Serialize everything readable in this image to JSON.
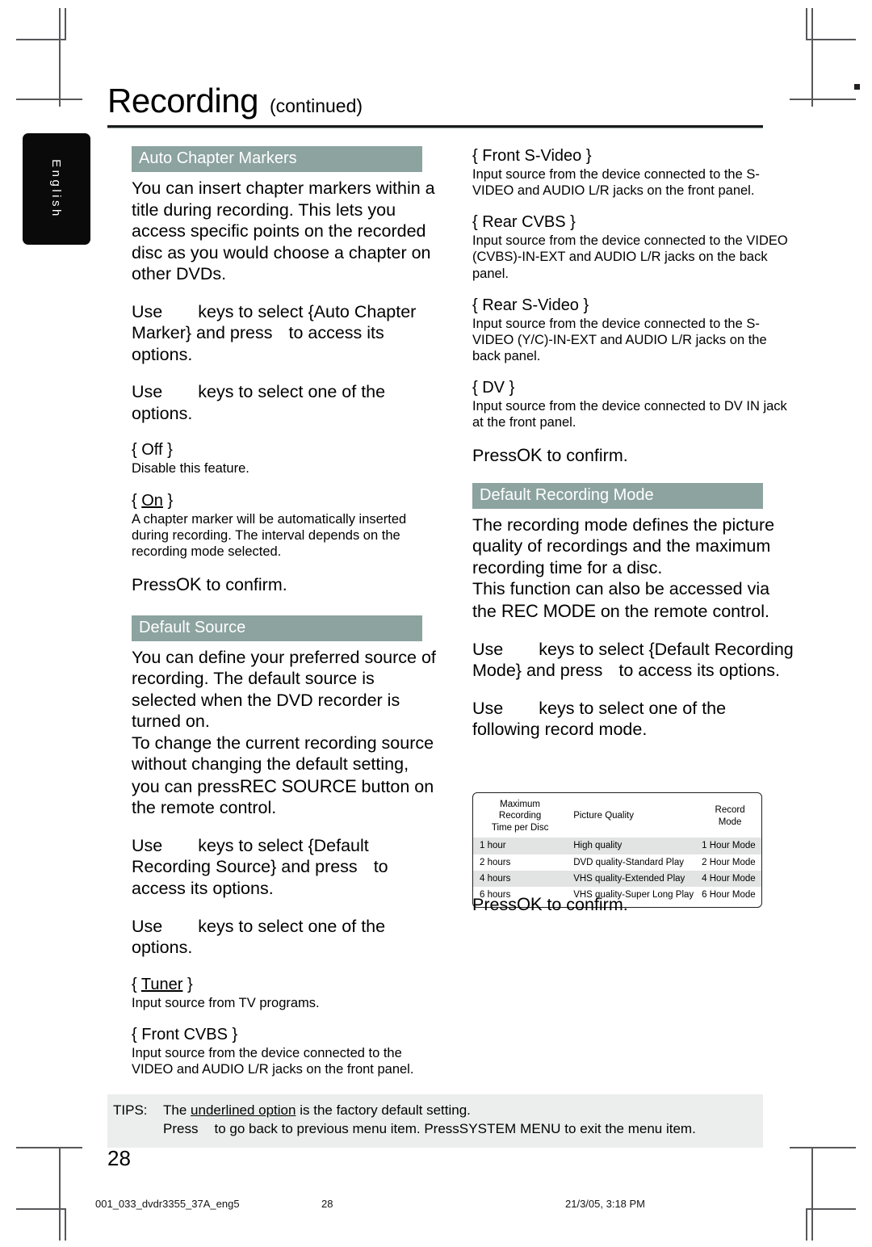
{
  "page": {
    "language_tab": "English",
    "folio": "28",
    "title": "Recording",
    "title_suffix": "(continued)"
  },
  "left_column": {
    "section1": {
      "heading": "Auto Chapter Markers",
      "intro": "You can insert chapter markers within a title during recording. This lets you access specific points on the recorded disc as you would choose a chapter on other DVDs.",
      "step1_a": "Use",
      "step1_b": "keys to select {",
      "step1_c": "Auto Chapter Marker",
      "step1_d": "} and press",
      "step1_e": "to access its options.",
      "step2_a": "Use",
      "step2_b": "keys to select one of the options.",
      "option_off": "{ Off }",
      "option_off_desc": "Disable this feature.",
      "option_on_open": "{",
      "option_on": "On",
      "option_on_close": "}",
      "option_on_desc": "A chapter marker will be automatically inserted during recording. The interval depends on the recording mode selected.",
      "confirm_a": "Press",
      "confirm_key": "OK",
      "confirm_b": "to confirm."
    },
    "section2": {
      "heading": "Default Source",
      "intro_1": "You can define your preferred source of recording. The default source is selected when the DVD recorder is turned on.",
      "intro_2_a": "To change the current recording source without changing the default setting, you can press",
      "intro_2_key": "REC SOURCE",
      "intro_2_b": "button on the remote control.",
      "step1_a": "Use",
      "step1_b": "keys to select {",
      "step1_c": "Default Recording Source",
      "step1_d": "} and press",
      "step1_e": "to access its options.",
      "step2_a": "Use",
      "step2_b": "keys to select one of the options.",
      "options": [
        {
          "label_open": "{",
          "label": "Tuner",
          "label_close": "}",
          "underlined": true,
          "desc": "Input source from TV programs."
        },
        {
          "label_open": "{",
          "label": "Front CVBS",
          "label_close": "}",
          "underlined": false,
          "desc": "Input source from the device connected to the VIDEO and AUDIO L/R jacks on the front panel."
        }
      ]
    }
  },
  "right_column": {
    "source_options_continued": [
      {
        "label": "{ Front S-Video  }",
        "desc": "Input source from the device connected to the S-VIDEO and AUDIO L/R jacks on the front panel."
      },
      {
        "label": "{ Rear CVBS }",
        "desc": "Input source from the device connected to the VIDEO (CVBS)-IN-EXT and AUDIO L/R jacks on the back panel."
      },
      {
        "label": "{ Rear S-Video }",
        "desc": "Input source from the device connected to the S-VIDEO (Y/C)-IN-EXT and AUDIO L/R jacks on the back panel."
      },
      {
        "label": "{ DV }",
        "desc": "Input source from the device connected to DV IN jack at the front panel."
      }
    ],
    "confirm_a": "Press",
    "confirm_key": "OK",
    "confirm_b": "to confirm.",
    "section3": {
      "heading": "Default Recording Mode",
      "intro_1": "The recording mode defines the picture quality of recordings and the maximum recording time for a disc.",
      "intro_2_a": "This function can also be accessed via the",
      "intro_2_key": "REC MODE",
      "intro_2_b": "on the remote control.",
      "step1_a": "Use",
      "step1_b": "keys to select {",
      "step1_c": "Default Recording Mode",
      "step1_d": "} and press",
      "step1_e": "to access its options.",
      "step2_a": "Use",
      "step2_b": "keys to select one of the following record mode.",
      "confirm_a": "Press",
      "confirm_key": "OK",
      "confirm_b": "to confirm."
    },
    "record_mode_table": {
      "columns": [
        "Maximum Recording Time per Disc",
        "Picture Quality",
        "Record Mode"
      ],
      "column_lines": [
        [
          "Maximum Recording",
          "Time per Disc"
        ],
        [
          "Picture Quality"
        ],
        [
          "Record",
          "Mode"
        ]
      ],
      "rows": [
        {
          "time": "1 hour",
          "quality": "High quality",
          "mode": "1 Hour Mode",
          "shaded": true
        },
        {
          "time": "2 hours",
          "quality": "DVD quality-Standard Play",
          "mode": "2 Hour Mode",
          "shaded": false
        },
        {
          "time": "4 hours",
          "quality": "VHS quality-Extended Play",
          "mode": "4 Hour Mode",
          "shaded": true
        },
        {
          "time": "6 hours",
          "quality": "VHS quality-Super Long Play",
          "mode": "6 Hour Mode",
          "shaded": false
        }
      ]
    }
  },
  "tips": {
    "label": "TIPS:",
    "line1_a": "The",
    "line1_underlined": "underlined option",
    "line1_b": "is the factory default  setting.",
    "line2_a": "Press",
    "line2_b": "to go back to previous menu item. Press",
    "line2_key": "SYSTEM MENU",
    "line2_c": "to exit the menu item."
  },
  "print_slug": {
    "file": "001_033_dvdr3355_37A_eng5",
    "page": "28",
    "date": "21/3/05, 3:18 PM"
  },
  "colors": {
    "section_bar": "#8ca3a0",
    "rule": "#1b1b1b",
    "tips_bg": "#eceeed",
    "table_shade": "#e2e4e3",
    "tab_bg": "#0a0a0a"
  }
}
